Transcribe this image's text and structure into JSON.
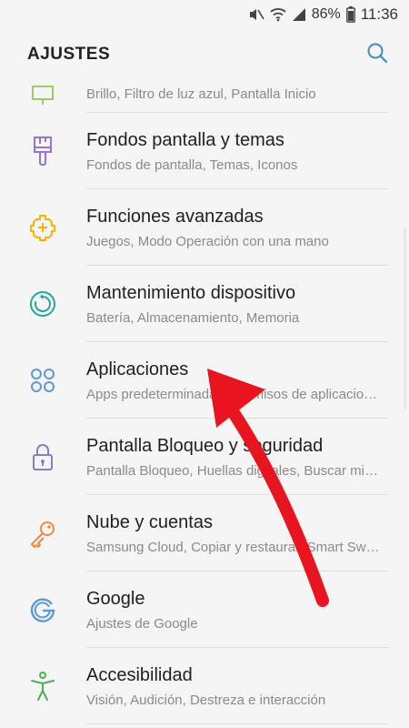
{
  "status_bar": {
    "battery": "86%",
    "time": "11:36",
    "icons": [
      "mute-icon",
      "wifi-icon",
      "signal-icon",
      "battery-icon"
    ]
  },
  "header": {
    "title": "AJUSTES",
    "search_icon": "search-icon"
  },
  "settings": {
    "items": [
      {
        "label": "",
        "sub": "Brillo, Filtro de luz azul, Pantalla Inicio",
        "icon": "display-icon",
        "color": "#9ccc65"
      },
      {
        "label": "Fondos pantalla y temas",
        "sub": "Fondos de pantalla, Temas, Iconos",
        "icon": "paintbrush-icon",
        "color": "#9575cd"
      },
      {
        "label": "Funciones avanzadas",
        "sub": "Juegos, Modo Operación con una mano",
        "icon": "puzzle-gear-icon",
        "color": "#f4b400"
      },
      {
        "label": "Mantenimiento dispositivo",
        "sub": "Batería, Almacenamiento, Memoria",
        "icon": "maintenance-icon",
        "color": "#26a69a"
      },
      {
        "label": "Aplicaciones",
        "sub": "Apps predeterminadas, Permisos de aplicaciones",
        "icon": "apps-grid-icon",
        "color": "#5c9ad6"
      },
      {
        "label": "Pantalla Bloqueo y seguridad",
        "sub": "Pantalla Bloqueo, Huellas digitales, Buscar mi móvil",
        "icon": "lock-icon",
        "color": "#8e7cc3"
      },
      {
        "label": "Nube y cuentas",
        "sub": "Samsung Cloud, Copiar y restaurar, Smart Switch",
        "icon": "key-icon",
        "color": "#ef8a3c"
      },
      {
        "label": "Google",
        "sub": "Ajustes de Google",
        "icon": "google-icon",
        "color": "#5c9ad6"
      },
      {
        "label": "Accesibilidad",
        "sub": "Visión, Audición, Destreza e interacción",
        "icon": "accessibility-icon",
        "color": "#4caf50"
      }
    ]
  },
  "annotation": {
    "arrow_color": "#e8141f"
  }
}
